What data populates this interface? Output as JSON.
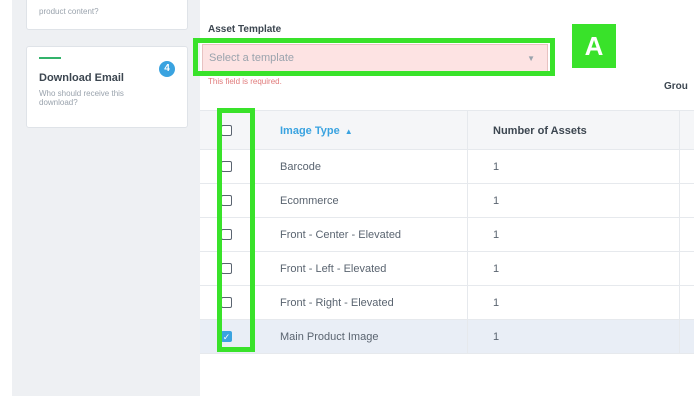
{
  "sidebar": {
    "prev_card": {
      "subtitle": "product content?"
    },
    "download_card": {
      "title": "Download Email",
      "description": "Who should receive this download?",
      "step": "4"
    }
  },
  "form": {
    "asset_template_label": "Asset Template",
    "template_placeholder": "Select a template",
    "error_text": "This field is required.",
    "partial_column_label": "Grou"
  },
  "annotation": {
    "callout": "A",
    "highlight_color": "#39e22a"
  },
  "table": {
    "headers": {
      "image_type": "Image Type",
      "number_of_assets": "Number of Assets"
    },
    "sort_indicator": "▲",
    "rows": [
      {
        "image_type": "Barcode",
        "count": "1",
        "checked": false
      },
      {
        "image_type": "Ecommerce",
        "count": "1",
        "checked": false
      },
      {
        "image_type": "Front - Center - Elevated",
        "count": "1",
        "checked": false
      },
      {
        "image_type": "Front - Left - Elevated",
        "count": "1",
        "checked": false
      },
      {
        "image_type": "Front - Right - Elevated",
        "count": "1",
        "checked": false
      },
      {
        "image_type": "Main Product Image",
        "count": "1",
        "checked": true
      }
    ]
  },
  "colors": {
    "accent": "#3aa3e0",
    "error_bg": "#fde3e3",
    "success": "#33b36b"
  }
}
